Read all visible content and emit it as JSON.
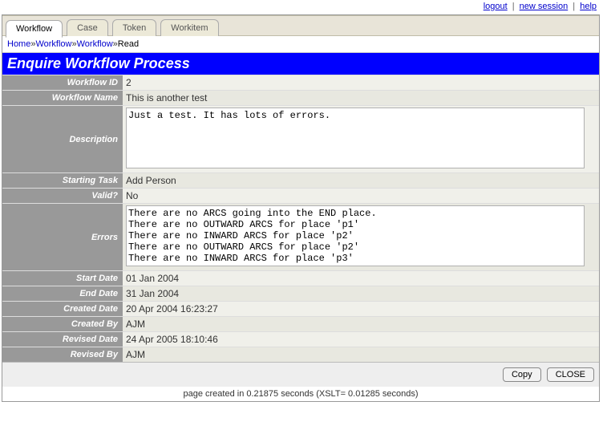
{
  "toplinks": {
    "logout": "logout",
    "new_session": "new session",
    "help": "help"
  },
  "tabs": [
    {
      "label": "Workflow",
      "active": true
    },
    {
      "label": "Case",
      "active": false
    },
    {
      "label": "Token",
      "active": false
    },
    {
      "label": "Workitem",
      "active": false
    }
  ],
  "breadcrumb": {
    "home": "Home",
    "w1": "Workflow",
    "w2": "Workflow",
    "read": "Read"
  },
  "title": "Enquire Workflow Process",
  "labels": {
    "workflow_id": "Workflow ID",
    "workflow_name": "Workflow Name",
    "description": "Description",
    "starting_task": "Starting Task",
    "valid": "Valid?",
    "errors": "Errors",
    "start_date": "Start Date",
    "end_date": "End Date",
    "created_date": "Created Date",
    "created_by": "Created By",
    "revised_date": "Revised Date",
    "revised_by": "Revised By"
  },
  "values": {
    "workflow_id": "2",
    "workflow_name": "This is another test",
    "description": "Just a test. It has lots of errors.",
    "starting_task": "Add Person",
    "valid": "No",
    "errors": "There are no ARCS going into the END place.\nThere are no OUTWARD ARCS for place 'p1'\nThere are no INWARD ARCS for place 'p2'\nThere are no OUTWARD ARCS for place 'p2'\nThere are no INWARD ARCS for place 'p3'",
    "start_date": "01 Jan 2004",
    "end_date": "31 Jan 2004",
    "created_date": "20 Apr 2004 16:23:27",
    "created_by": "AJM",
    "revised_date": "24 Apr 2005 18:10:46",
    "revised_by": "AJM"
  },
  "buttons": {
    "copy": "Copy",
    "close": "CLOSE"
  },
  "pageinfo": "page created in 0.21875 seconds (XSLT= 0.01285 seconds)"
}
